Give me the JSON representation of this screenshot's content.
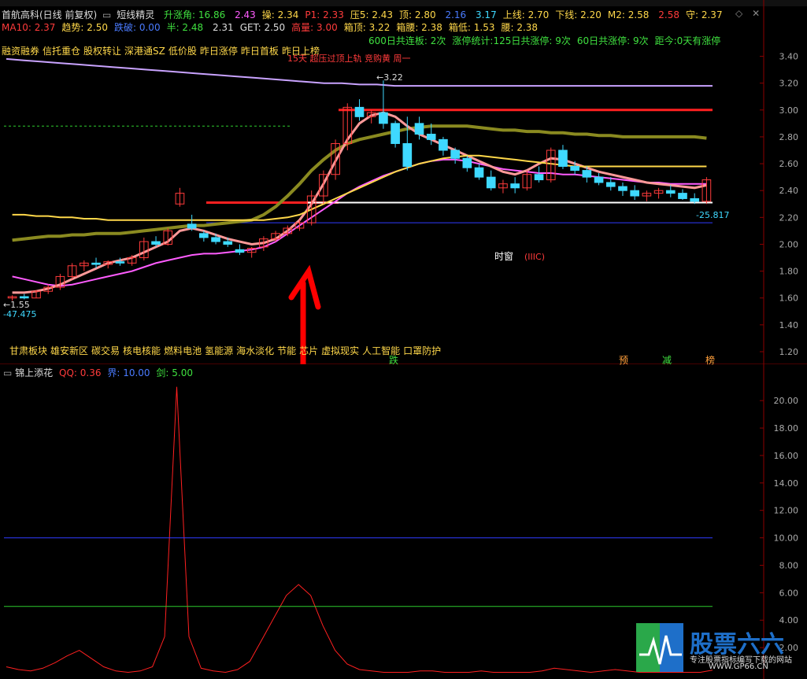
{
  "header": {
    "stock_title": "首航高科(日线 前复权)",
    "indicator_name": "短线精灵",
    "row1": [
      {
        "label": "升涨角:",
        "value": "16.86",
        "color": "#3fe03f"
      },
      {
        "label": "",
        "value": "2.43",
        "color": "#ff5cff"
      },
      {
        "label": "操:",
        "value": "2.34",
        "color": "#ffd84a"
      },
      {
        "label": "P1:",
        "value": "2.33",
        "color": "#ff3b3b"
      },
      {
        "label": "压5:",
        "value": "2.43",
        "color": "#ffd84a"
      },
      {
        "label": "顶:",
        "value": "2.80",
        "color": "#ffd84a"
      },
      {
        "label": "",
        "value": "2.16",
        "color": "#4a7bff"
      },
      {
        "label": "",
        "value": "3.17",
        "color": "#3fd9ff"
      },
      {
        "label": "上线:",
        "value": "2.70",
        "color": "#ffd84a"
      },
      {
        "label": "下线:",
        "value": "2.20",
        "color": "#ffd84a"
      },
      {
        "label": "M2:",
        "value": "2.58",
        "color": "#ffd84a"
      },
      {
        "label": "",
        "value": "2.58",
        "color": "#ff3b3b"
      },
      {
        "label": "守:",
        "value": "2.37",
        "color": "#ffd84a"
      }
    ],
    "row2": [
      {
        "label": "MA10:",
        "value": "2.37",
        "color": "#ff3b3b"
      },
      {
        "label": "趋势:",
        "value": "2.50",
        "color": "#ffd84a"
      },
      {
        "label": "跌破:",
        "value": "0.00",
        "color": "#4a7bff"
      },
      {
        "label": "半:",
        "value": "2.48",
        "color": "#3fe03f"
      },
      {
        "label": "",
        "value": "2.31",
        "color": "#dddddd"
      },
      {
        "label": "GET:",
        "value": "2.50",
        "color": "#dddddd"
      },
      {
        "label": "高量:",
        "value": "3.00",
        "color": "#ff3b3b"
      },
      {
        "label": "箱顶:",
        "value": "3.22",
        "color": "#ffd84a"
      },
      {
        "label": "箱腰:",
        "value": "2.38",
        "color": "#ffd84a"
      },
      {
        "label": "箱低:",
        "value": "1.53",
        "color": "#ffd84a"
      },
      {
        "label": "腰:",
        "value": "2.38",
        "color": "#ffd84a"
      }
    ],
    "row3": [
      {
        "text": "600日共连板: 2次",
        "color": "#3fe03f"
      },
      {
        "text": "涨停统计:125日共涨停: 9次",
        "color": "#3fe03f"
      },
      {
        "text": "60日共涨停: 9次",
        "color": "#3fe03f"
      },
      {
        "text": "距今:0天有涨停",
        "color": "#3fe03f"
      }
    ]
  },
  "concepts_top": [
    "融资融券",
    "信托重仓",
    "股权转让",
    "深港通SZ",
    "低价股",
    "昨日涨停",
    "昨日首板",
    "昨日上榜"
  ],
  "concepts_bottom": [
    "甘肃板块",
    "雄安新区",
    "碳交易",
    "核电核能",
    "燃料电池",
    "氢能源",
    "海水淡化",
    "节能",
    "芯片",
    "虚拟现实",
    "人工智能",
    "口罩防护"
  ],
  "annotation_top": "15天 超压过顶上轨 竞购黄 周一",
  "main_axis": [
    "3.40",
    "3.20",
    "3.00",
    "2.80",
    "2.60",
    "2.40",
    "2.20",
    "2.00",
    "1.80",
    "1.60",
    "1.40",
    "1.20"
  ],
  "sub_axis": [
    "20.00",
    "18.00",
    "16.00",
    "14.00",
    "12.00",
    "10.00",
    "8.00",
    "6.00",
    "4.00",
    "2.00"
  ],
  "sub_header": {
    "name": "锦上添花",
    "qq_label": "QQ:",
    "qq_value": "0.36",
    "jie_label": "界:",
    "jie_value": "10.00",
    "jian_label": "剑:",
    "jian_value": "5.00"
  },
  "markers": {
    "price_high": "3.22",
    "price_low": "1.55",
    "readout_left": "-47.475",
    "readout_right": "-25.817",
    "shichuang": "时窗",
    "wave": "(IIIC)"
  },
  "bottom_tags": [
    "跌",
    "预",
    "减",
    "榜"
  ],
  "logo": {
    "title": "股票六六",
    "subtitle": "专注股票指标编写下载的网站",
    "url": "WWW.GP66.CN"
  },
  "colors": {
    "up": "#ff3b3b",
    "down": "#3fd9ff",
    "grid": "#8b0000"
  },
  "chart_data": [
    {
      "type": "candlestick",
      "title": "首航高科(日线 前复权)",
      "ylim": [
        1.2,
        3.45
      ],
      "candles": [
        [
          1.6,
          1.62,
          1.58,
          1.61
        ],
        [
          1.61,
          1.63,
          1.59,
          1.6
        ],
        [
          1.6,
          1.66,
          1.6,
          1.65
        ],
        [
          1.65,
          1.7,
          1.63,
          1.68
        ],
        [
          1.68,
          1.78,
          1.66,
          1.76
        ],
        [
          1.76,
          1.86,
          1.74,
          1.84
        ],
        [
          1.84,
          1.88,
          1.8,
          1.86
        ],
        [
          1.86,
          1.9,
          1.82,
          1.85
        ],
        [
          1.85,
          1.88,
          1.82,
          1.87
        ],
        [
          1.87,
          1.9,
          1.84,
          1.86
        ],
        [
          1.86,
          1.92,
          1.84,
          1.9
        ],
        [
          1.9,
          2.05,
          1.88,
          2.02
        ],
        [
          2.02,
          2.06,
          1.98,
          2.0
        ],
        [
          2.0,
          2.12,
          1.99,
          2.1
        ],
        [
          2.3,
          2.42,
          2.28,
          2.38
        ],
        [
          2.15,
          2.22,
          2.1,
          2.12
        ],
        [
          2.08,
          2.1,
          2.02,
          2.05
        ],
        [
          2.05,
          2.08,
          2.0,
          2.02
        ],
        [
          2.02,
          2.05,
          1.98,
          2.0
        ],
        [
          1.96,
          2.0,
          1.92,
          1.94
        ],
        [
          1.94,
          1.98,
          1.9,
          1.97
        ],
        [
          1.98,
          2.06,
          1.95,
          2.04
        ],
        [
          2.04,
          2.1,
          2.02,
          2.08
        ],
        [
          2.08,
          2.14,
          2.06,
          2.12
        ],
        [
          2.12,
          2.18,
          2.1,
          2.16
        ],
        [
          2.16,
          2.4,
          2.14,
          2.36
        ],
        [
          2.36,
          2.55,
          2.3,
          2.52
        ],
        [
          2.52,
          2.78,
          2.48,
          2.75
        ],
        [
          2.75,
          3.05,
          2.7,
          3.02
        ],
        [
          3.02,
          3.08,
          2.92,
          2.95
        ],
        [
          2.95,
          3.0,
          2.9,
          2.98
        ],
        [
          2.98,
          3.22,
          2.86,
          2.9
        ],
        [
          2.9,
          2.92,
          2.72,
          2.75
        ],
        [
          2.75,
          2.95,
          2.55,
          2.58
        ],
        [
          2.9,
          2.95,
          2.78,
          2.82
        ],
        [
          2.82,
          2.9,
          2.74,
          2.78
        ],
        [
          2.78,
          2.8,
          2.66,
          2.7
        ],
        [
          2.7,
          2.72,
          2.6,
          2.64
        ],
        [
          2.64,
          2.66,
          2.54,
          2.57
        ],
        [
          2.57,
          2.6,
          2.48,
          2.5
        ],
        [
          2.5,
          2.55,
          2.4,
          2.42
        ],
        [
          2.42,
          2.48,
          2.38,
          2.45
        ],
        [
          2.45,
          2.5,
          2.38,
          2.42
        ],
        [
          2.42,
          2.55,
          2.4,
          2.52
        ],
        [
          2.52,
          2.58,
          2.46,
          2.48
        ],
        [
          2.48,
          2.72,
          2.46,
          2.7
        ],
        [
          2.7,
          2.74,
          2.56,
          2.58
        ],
        [
          2.58,
          2.62,
          2.52,
          2.55
        ],
        [
          2.55,
          2.58,
          2.46,
          2.5
        ],
        [
          2.5,
          2.53,
          2.44,
          2.46
        ],
        [
          2.46,
          2.5,
          2.4,
          2.43
        ],
        [
          2.43,
          2.46,
          2.36,
          2.4
        ],
        [
          2.4,
          2.44,
          2.33,
          2.36
        ],
        [
          2.36,
          2.4,
          2.32,
          2.38
        ],
        [
          2.38,
          2.42,
          2.34,
          2.4
        ],
        [
          2.4,
          2.44,
          2.35,
          2.38
        ],
        [
          2.38,
          2.41,
          2.33,
          2.34
        ],
        [
          2.34,
          2.38,
          2.3,
          2.32
        ],
        [
          2.32,
          2.5,
          2.3,
          2.48
        ]
      ],
      "lines": [
        {
          "name": "",
          "color": "#c9a3ff",
          "values": [
            3.38,
            3.37,
            3.36,
            3.35,
            3.34,
            3.33,
            3.32,
            3.31,
            3.3,
            3.29,
            3.28,
            3.27,
            3.26,
            3.25,
            3.24,
            3.23,
            3.22,
            3.21,
            3.2,
            3.2,
            3.19,
            3.19,
            3.18,
            3.18,
            3.18,
            3.18,
            3.18,
            3.18,
            3.18,
            3.18,
            3.18,
            3.18,
            3.18,
            3.18,
            3.18,
            3.18,
            3.18,
            3.18,
            3.18,
            3.18,
            3.18
          ]
        },
        {
          "name": "",
          "color": "#8a8a20",
          "values": [
            2.03,
            2.04,
            2.05,
            2.06,
            2.06,
            2.07,
            2.07,
            2.08,
            2.08,
            2.08,
            2.09,
            2.1,
            2.11,
            2.12,
            2.13,
            2.14,
            2.14,
            2.15,
            2.16,
            2.17,
            2.18,
            2.22,
            2.28,
            2.36,
            2.45,
            2.55,
            2.63,
            2.7,
            2.75,
            2.78,
            2.8,
            2.82,
            2.84,
            2.86,
            2.87,
            2.88,
            2.88,
            2.88,
            2.88,
            2.87,
            2.86,
            2.85,
            2.85,
            2.84,
            2.84,
            2.83,
            2.83,
            2.82,
            2.82,
            2.81,
            2.81,
            2.8,
            2.8,
            2.8,
            2.8,
            2.8,
            2.8,
            2.8,
            2.79
          ]
        },
        {
          "name": "",
          "color": "#ff5cff",
          "values": [
            1.76,
            1.74,
            1.72,
            1.7,
            1.69,
            1.7,
            1.72,
            1.74,
            1.76,
            1.78,
            1.8,
            1.83,
            1.86,
            1.88,
            1.9,
            1.92,
            1.93,
            1.93,
            1.94,
            1.95,
            1.96,
            1.98,
            2.02,
            2.08,
            2.14,
            2.2,
            2.26,
            2.32,
            2.38,
            2.43,
            2.47,
            2.51,
            2.54,
            2.57,
            2.6,
            2.62,
            2.63,
            2.63,
            2.62,
            2.6,
            2.58,
            2.56,
            2.55,
            2.54,
            2.53,
            2.53,
            2.52,
            2.52,
            2.51,
            2.5,
            2.49,
            2.48,
            2.47,
            2.46,
            2.46,
            2.45,
            2.45,
            2.45,
            2.45
          ]
        },
        {
          "name": "",
          "color": "#ff9999",
          "values": [
            1.64,
            1.64,
            1.65,
            1.67,
            1.7,
            1.74,
            1.78,
            1.82,
            1.86,
            1.88,
            1.9,
            1.94,
            1.98,
            2.02,
            2.1,
            2.12,
            2.1,
            2.07,
            2.04,
            2.02,
            2.0,
            2.01,
            2.04,
            2.1,
            2.18,
            2.3,
            2.45,
            2.62,
            2.78,
            2.9,
            2.96,
            2.98,
            2.95,
            2.88,
            2.82,
            2.78,
            2.74,
            2.7,
            2.66,
            2.62,
            2.58,
            2.54,
            2.52,
            2.55,
            2.6,
            2.64,
            2.63,
            2.6,
            2.57,
            2.54,
            2.52,
            2.5,
            2.48,
            2.46,
            2.45,
            2.44,
            2.43,
            2.42,
            2.44
          ]
        },
        {
          "name": "",
          "color": "#ffd84a",
          "values": [
            2.22,
            2.22,
            2.21,
            2.21,
            2.2,
            2.2,
            2.19,
            2.19,
            2.18,
            2.18,
            2.18,
            2.18,
            2.18,
            2.18,
            2.18,
            2.18,
            2.18,
            2.18,
            2.18,
            2.18,
            2.18,
            2.18,
            2.19,
            2.2,
            2.22,
            2.26,
            2.3,
            2.34,
            2.38,
            2.42,
            2.46,
            2.5,
            2.54,
            2.57,
            2.6,
            2.62,
            2.64,
            2.65,
            2.66,
            2.66,
            2.65,
            2.64,
            2.63,
            2.62,
            2.61,
            2.6,
            2.59,
            2.58,
            2.58,
            2.58,
            2.58,
            2.58,
            2.58,
            2.58,
            2.58,
            2.58,
            2.58,
            2.58,
            2.58
          ]
        }
      ]
    },
    {
      "type": "line",
      "title": "锦上添花",
      "ylim": [
        0,
        21.5
      ],
      "series": [
        {
          "name": "QQ",
          "color": "#ff2020",
          "values": [
            0.6,
            0.4,
            0.3,
            0.5,
            0.9,
            1.4,
            1.8,
            1.2,
            0.6,
            0.3,
            0.2,
            0.3,
            0.6,
            2.8,
            21.0,
            2.8,
            0.5,
            0.3,
            0.2,
            0.4,
            1.0,
            2.6,
            4.2,
            5.8,
            6.6,
            5.8,
            3.6,
            1.8,
            0.8,
            0.4,
            0.3,
            0.2,
            0.2,
            0.2,
            0.3,
            0.3,
            0.2,
            0.2,
            0.2,
            0.3,
            0.2,
            0.2,
            0.2,
            0.2,
            0.3,
            0.5,
            0.4,
            0.3,
            0.2,
            0.3,
            0.4,
            0.3,
            0.2,
            0.2,
            0.2,
            0.2,
            0.2,
            0.2,
            0.36
          ]
        },
        {
          "name": "界",
          "color": "#2f3bff",
          "values": [
            10.0
          ]
        },
        {
          "name": "剑",
          "color": "#2ecc2e",
          "values": [
            5.0
          ]
        }
      ]
    }
  ]
}
